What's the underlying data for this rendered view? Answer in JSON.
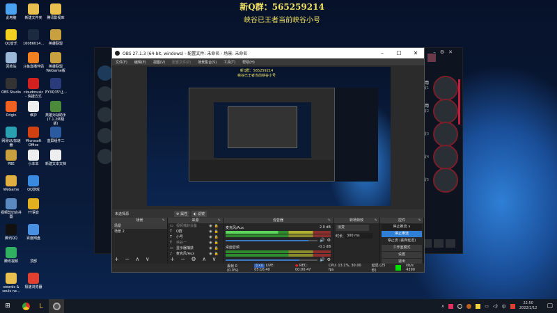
{
  "banner": {
    "line1": "新Q群：565259214",
    "line2": "峡谷已王者当前峡谷小号"
  },
  "desktop_icons": [
    {
      "label": "此电脑",
      "color": "#4aa3f0"
    },
    {
      "label": "新建文件夹",
      "color": "#e8c050"
    },
    {
      "label": "腾讯影视库",
      "color": "#e8c050"
    },
    {
      "label": "QQ音乐",
      "color": "#f0d020"
    },
    {
      "label": "16086014...",
      "color": "#1c2a40"
    },
    {
      "label": "英雄联盟",
      "color": "#c9a040"
    },
    {
      "label": "回收站",
      "color": "#9bb8d8"
    },
    {
      "label": "斗鱼直播伴侣",
      "color": "#f08020"
    },
    {
      "label": "英雄联盟 WeGame版",
      "color": "#c9a040"
    },
    {
      "label": "OBS Studio",
      "color": "#333"
    },
    {
      "label": "cloudmusic - 快捷方式",
      "color": "#d02020"
    },
    {
      "label": "EYXQ35'让...",
      "color": "#2a3a7a"
    },
    {
      "label": "Origin",
      "color": "#f06020"
    },
    {
      "label": "维护",
      "color": "#eee"
    },
    {
      "label": "英雄对战助手 (7.1.2终极版)",
      "color": "#4a8a3a"
    },
    {
      "label": "网易UU加速器",
      "color": "#2aa0b0"
    },
    {
      "label": "Microsoft Office",
      "color": "#d04010"
    },
    {
      "label": "蓝屏组件二",
      "color": "#2a5aa0"
    },
    {
      "label": "PBE",
      "color": "#c9a040"
    },
    {
      "label": "小本本",
      "color": "#eee"
    },
    {
      "label": "新建文本文档",
      "color": "#eee"
    },
    {
      "label": "WeGame",
      "color": "#e0b040"
    },
    {
      "label": "QQ游戏",
      "color": "#3a8ae0"
    },
    {
      "label": "视频剪切合并器",
      "color": "#5a8ac0"
    },
    {
      "label": "YY语音",
      "color": "#e0b020"
    },
    {
      "label": "腾讯QQ",
      "color": "#111"
    },
    {
      "label": "百度网盘",
      "color": "#4a90e0"
    },
    {
      "label": "腾讯视频",
      "color": "#30b060"
    },
    {
      "label": "顶部",
      "color": "transparent"
    },
    {
      "label": "swords & souls ne...",
      "color": "#e8c050"
    },
    {
      "label": "极速浏览器",
      "color": "#e04030"
    }
  ],
  "game_client": {
    "slots": [
      {
        "title": "开始选用",
        "sub": "位置1"
      },
      {
        "title": "开始选用",
        "sub": "位置2"
      },
      {
        "title": "",
        "sub": "位置3"
      },
      {
        "title": "",
        "sub": "位置4"
      },
      {
        "title": "",
        "sub": "位置5"
      }
    ]
  },
  "obs": {
    "title": "OBS 27.1.3 (64-bit, windows) - 配置文件: 未命名 - 场景: 未命名",
    "window_controls": [
      "–",
      "☐",
      "✕"
    ],
    "menu": [
      "文件(F)",
      "编辑(E)",
      "视图(V)",
      "配置文件(P)",
      "场景集合(S)",
      "工具(T)",
      "帮助(H)"
    ],
    "toolbar": {
      "selected": "未选择源",
      "properties": "属性",
      "filters": "滤镜"
    },
    "scenes": {
      "header": "场景",
      "items": [
        "场景",
        "场景 2"
      ]
    },
    "sources": {
      "header": "来源",
      "items": [
        "视频捕获设备",
        "Q群",
        "小号",
        "峡谷一",
        "显示器捕获",
        "麦克风/Aux"
      ]
    },
    "mixer": {
      "header": "混音器",
      "channels": [
        {
          "name": "麦克风/Aux",
          "db": "2.0 dB",
          "volume": 0.9
        },
        {
          "name": "桌面音频",
          "db": "-0.1 dB",
          "volume": 0.8
        }
      ]
    },
    "transitions": {
      "header": "转场特效",
      "type": "淡变",
      "duration_label": "时长",
      "duration": "300 ms"
    },
    "controls": {
      "header": "控件",
      "dropdown": "停止推流",
      "menu": [
        "停止推流",
        "停止流 (丢弃延迟)",
        "工作室模式",
        "设置",
        "退出"
      ]
    },
    "status": {
      "dropped": "丢帧 0 (0.0%)",
      "live": "LIVE: 05:16:40",
      "rec": "REC: 00:00:47",
      "cpu": "CPU: 13.1%, 30.00 fps",
      "delay": "延迟 (25 秒)",
      "bitrate": "kb/s: 4390",
      "health_color": "#00e000"
    }
  },
  "taskbar": {
    "time": "22:50",
    "date": "2022/2/12"
  }
}
